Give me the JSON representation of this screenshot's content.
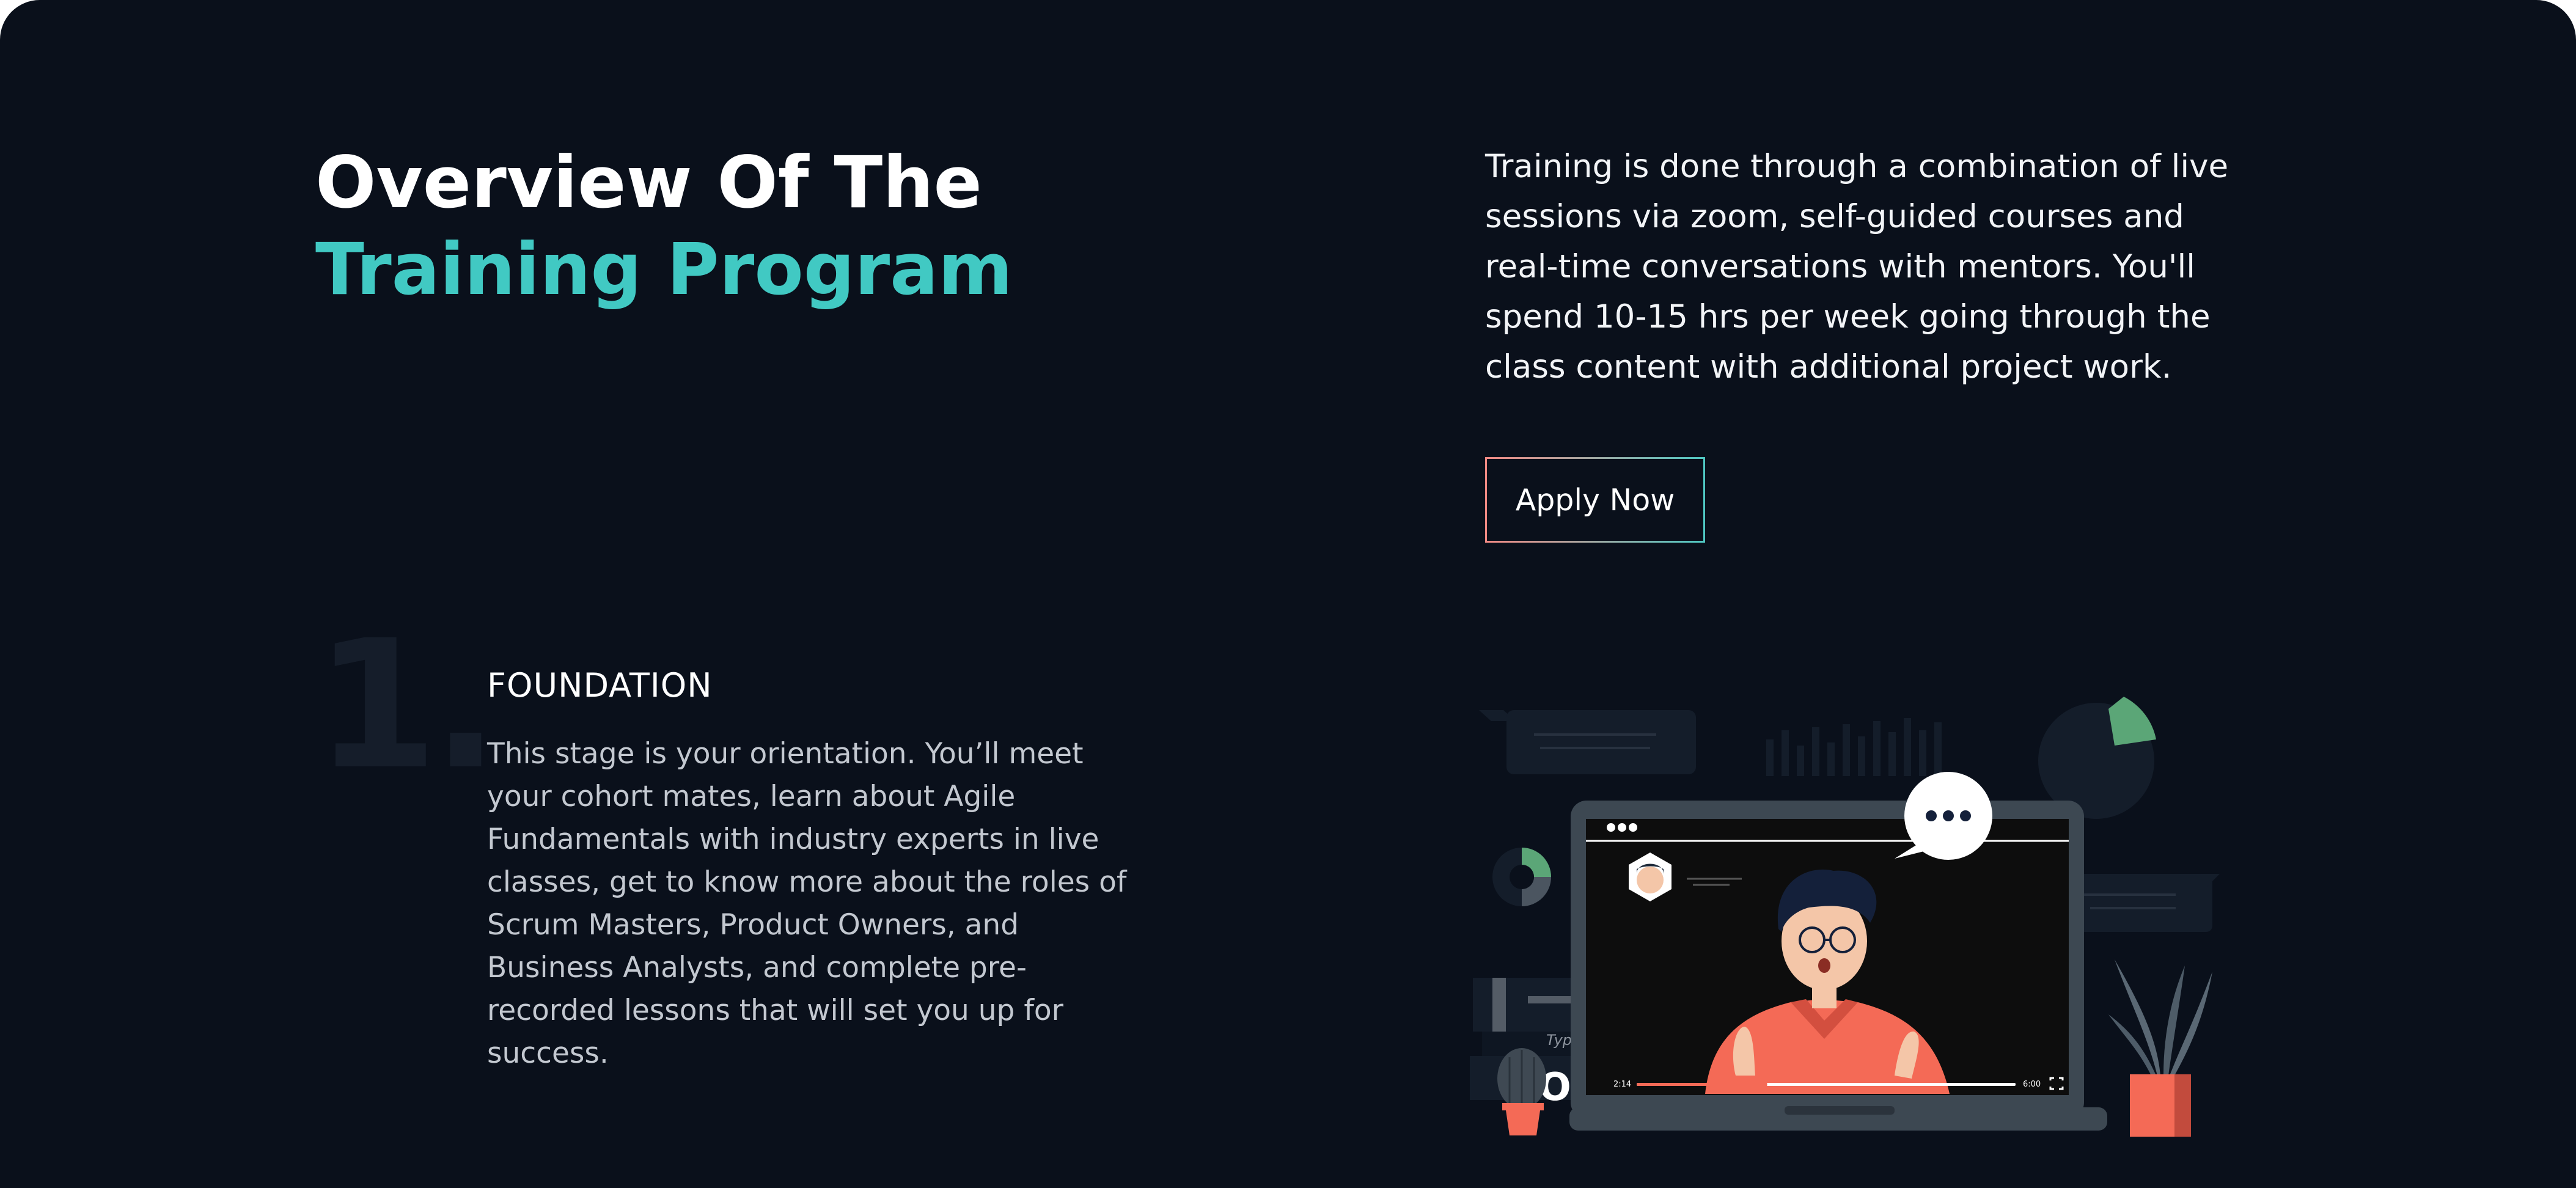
{
  "overview": {
    "title_line1": "Overview Of The",
    "title_line2": "Training Program",
    "description": "Training is done through a combination of live sessions via zoom, self-guided courses and real-time conversations with mentors. You'll spend 10-15 hrs per week going through the class content with additional project work.",
    "apply_label": "Apply Now"
  },
  "stage": {
    "number": "1.",
    "title": "FOUNDATION",
    "text": "This stage is your orientation. You’ll meet your cohort mates, learn about Agile Fundamentals with industry experts in live classes, get to know more about the roles of Scrum Masters, Product Owners, and Business Analysts, and complete pre-recorded lessons that will set you up for success."
  },
  "illustration": {
    "video_current_time": "2:14",
    "video_total_time": "6:00",
    "video_progress": 0.33,
    "book_spine_text": "Typo",
    "book_cover_text": "OLO"
  },
  "colors": {
    "background": "#0a101b",
    "accent_teal": "#41c9c3",
    "accent_coral": "#f46a56"
  }
}
